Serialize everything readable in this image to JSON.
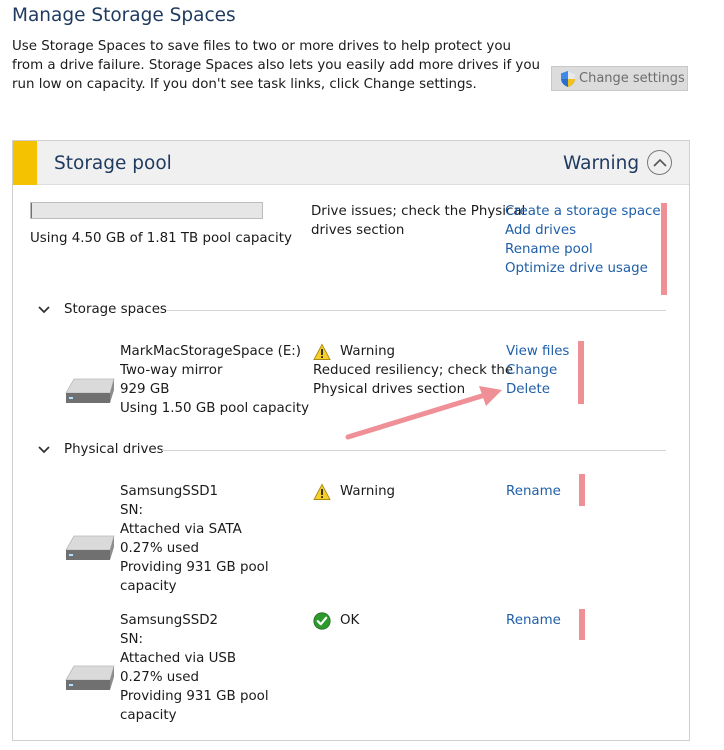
{
  "page": {
    "title": "Manage Storage Spaces",
    "description": "Use Storage Spaces to save files to two or more drives to help protect you from a drive failure. Storage Spaces also lets you easily add more drives if you run low on capacity. If you don't see task links, click Change settings.",
    "change_settings_label": "Change settings"
  },
  "pool": {
    "title": "Storage pool",
    "status": "Warning",
    "usage_fraction": 0.0024,
    "capacity_text": "Using 4.50 GB of 1.81 TB pool capacity",
    "issue_line1": "Drive issues; check the Physical",
    "issue_line2": "drives section",
    "links": [
      "Create a storage space",
      "Add drives",
      "Rename pool",
      "Optimize drive usage"
    ]
  },
  "storage_spaces": {
    "label": "Storage spaces",
    "items": [
      {
        "name": "MarkMacStorageSpace (E:)",
        "resiliency": "Two-way mirror",
        "size": "929 GB",
        "usage": "Using 1.50 GB pool capacity",
        "status": "Warning",
        "status_line1": "Reduced resiliency; check the",
        "status_line2": "Physical drives section",
        "links": [
          "View files",
          "Change",
          "Delete"
        ]
      }
    ]
  },
  "physical_drives": {
    "label": "Physical drives",
    "items": [
      {
        "name": "SamsungSSD1",
        "sn": "SN:",
        "attached": "Attached via SATA",
        "used": "0.27% used",
        "providing_line1": "Providing 931 GB pool",
        "providing_line2": "capacity",
        "status": "Warning",
        "link": "Rename"
      },
      {
        "name": "SamsungSSD2",
        "sn": "SN:",
        "attached": "Attached via USB",
        "used": "0.27% used",
        "providing_line1": "Providing 931 GB pool",
        "providing_line2": "capacity",
        "status": "OK",
        "link": "Rename"
      }
    ]
  },
  "colors": {
    "title": "#1e3a5f",
    "link": "#1f5fa8",
    "warning_accent": "#f4c200",
    "annotation": "#ef8f96",
    "ok": "#2e9a2e"
  },
  "icons": {
    "shield": "uac-shield-icon",
    "collapse": "chevron-up-icon",
    "section": "chevron-down-icon",
    "drive": "drive-icon",
    "warning": "warning-icon",
    "ok": "ok-check-icon"
  }
}
